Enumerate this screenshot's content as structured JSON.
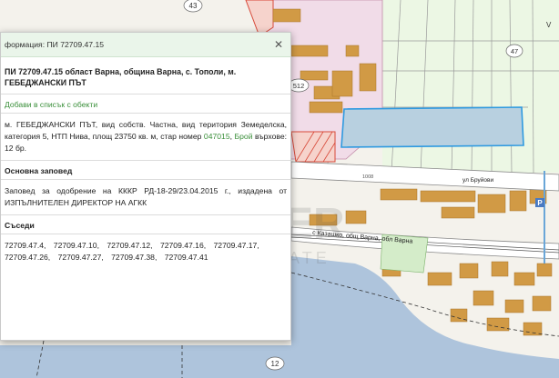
{
  "panel": {
    "title": "формация: ПИ 72709.47.15",
    "heading": "ПИ 72709.47.15 област Варна, община Варна, с. Тополи, м. ГЕБЕДЖАНСКИ ПЪТ",
    "add_link": "Добави в списък с обекти",
    "description_pre": "м. ГЕБЕДЖАНСКИ ПЪТ, вид собств. Частна, вид територия Земеделска, категория 5, НТП Нива, площ 23750 кв. м, стар номер ",
    "old_number": "047015",
    "description_mid": ", ",
    "floors_label": "Брой",
    "description_post": " върхове: 12 бр.",
    "order_heading": "Основна заповед",
    "order_text": "Заповед за одобрение на КККР РД-18-29/23.04.2015 г., издадена от ИЗПЪЛНИТЕЛЕН ДИРЕКТОР НА АГКК",
    "neighbors_heading": "Съседи",
    "neighbors": [
      "72709.47.4,",
      "72709.47.10,",
      "72709.47.12,",
      "72709.47.16,",
      "72709.47.17,",
      "72709.47.26,",
      "72709.47.27,",
      "72709.47.38,",
      "72709.47.41"
    ]
  },
  "map": {
    "labels": {
      "parcel_43": "43",
      "parcel_47": "47",
      "parcel_v": "V",
      "parcel_512": "512",
      "parcel_12": "12",
      "road_kazashko": "с Казашко, общ Варна, обл Варна",
      "road_label2": "ул Бруйови",
      "road_1008": "1008",
      "p_sign": "P"
    },
    "watermark": "PREMIER",
    "watermark_sub": "REAL ESTATE"
  }
}
